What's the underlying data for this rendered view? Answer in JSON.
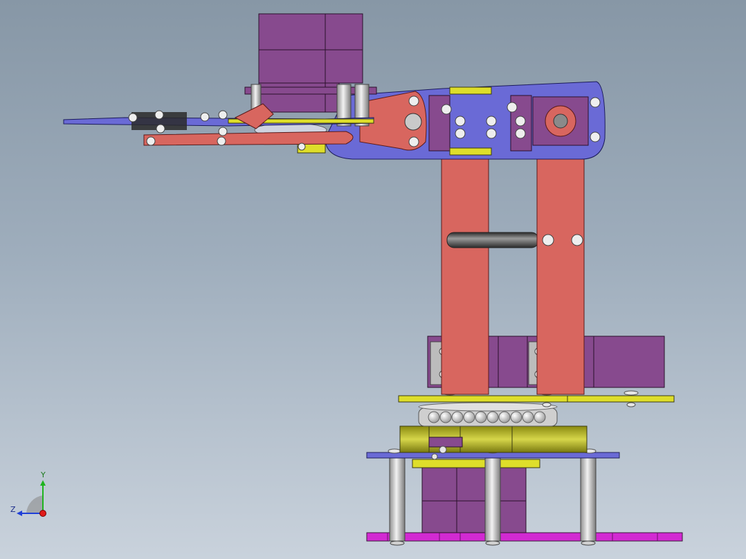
{
  "viewport": {
    "background_top": "#8797a6",
    "background_bottom": "#c9d2dc"
  },
  "colors": {
    "servo_purple": "#874a8e",
    "bracket_blue": "#6a6ad6",
    "link_salmon": "#d8665f",
    "plate_yellow": "#dede2a",
    "base_magenta": "#d22ad2",
    "standoff_grey": "#bdbdbd",
    "olive_gear": "#b8b82a",
    "screw_white": "#e6e6e6"
  },
  "triad": {
    "y_label": "Y",
    "z_label": "Z",
    "y_color": "#1fb41f",
    "z_color": "#1f3fd8",
    "x_color": "#e01a1a",
    "icon": "view-orientation-triad-icon"
  }
}
